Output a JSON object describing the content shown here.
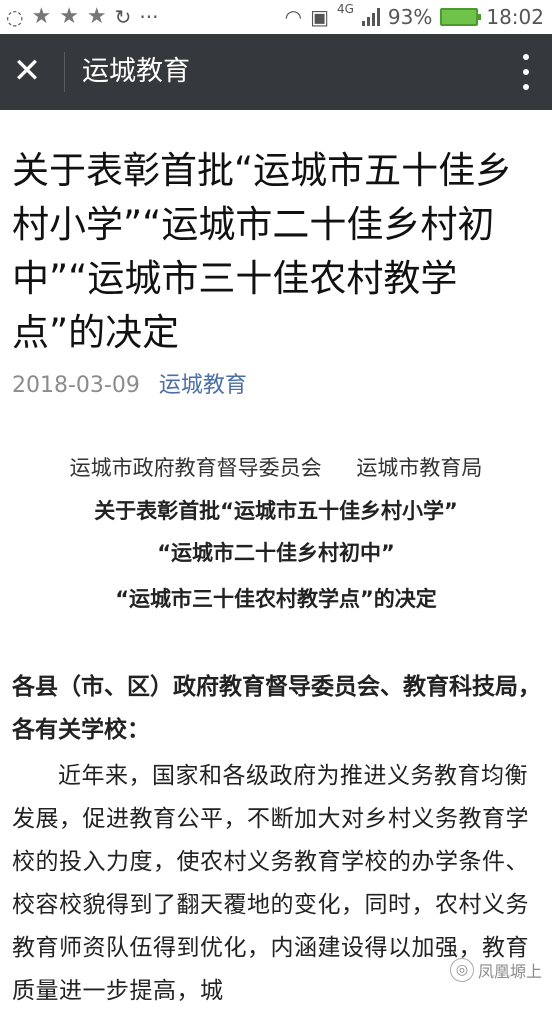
{
  "status_bar": {
    "left_icons": [
      "chat-icon",
      "star-icon",
      "star-icon",
      "star-icon",
      "refresh-icon",
      "more-icon"
    ],
    "network": "4G",
    "battery": "93%",
    "time": "18:02",
    "colors": {
      "battery_fill": "#6fc34a"
    }
  },
  "navbar": {
    "title": "运城教育",
    "background": "#35383c"
  },
  "article": {
    "title": "关于表彰首批“运城市五十佳乡村小学”“运城市二十佳乡村初中”“运城市三十佳农村教学点”的决定",
    "date": "2018-03-09",
    "author": "运城教育",
    "issuers": [
      "运城市政府教育督导委员会",
      "运城市教育局"
    ],
    "subtitle_lines": [
      "关于表彰首批“运城市五十佳乡村小学”",
      "“运城市二十佳乡村初中”",
      "“运城市三十佳农村教学点”的决定"
    ],
    "salutation": "各县（市、区）政府教育督导委员会、教育科技局，各有关学校：",
    "body": "近年来，国家和各级政府为推进义务教育均衡发展，促进教育公平，不断加大对乡村义务教育学校的投入力度，使农村义务教育学校的办学条件、校容校貌得到了翻天覆地的变化，同时，农村义务教育师资队伍得到优化，内涵建设得以加强，教育质量进一步提高，城"
  },
  "watermark": {
    "text": "凤凰塬上"
  }
}
